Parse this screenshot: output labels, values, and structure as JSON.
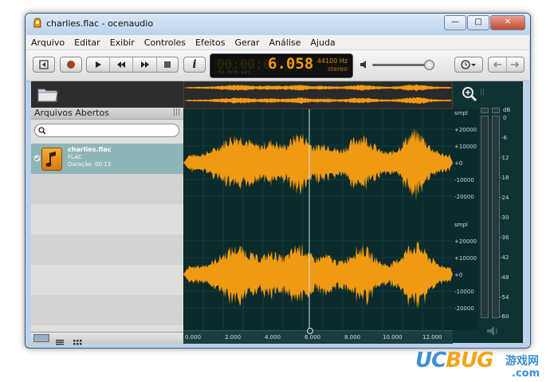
{
  "window": {
    "title": "charlies.flac - ocenaudio"
  },
  "menu": [
    "Arquivo",
    "Editar",
    "Exibir",
    "Controles",
    "Efeitos",
    "Gerar",
    "Análise",
    "Ajuda"
  ],
  "display": {
    "dim_digits": "00:00:0",
    "time": "6.058",
    "units": "hr  min sec",
    "sample_rate": "44100 Hz",
    "channels": "stereo"
  },
  "sidebar": {
    "header": "Arquivos Abertos",
    "search_placeholder": "",
    "files": [
      {
        "name": "charlies.flac",
        "format": "FLAC",
        "duration": "Duração: 00:13"
      }
    ]
  },
  "waveform": {
    "y_axis_top": [
      "smpl",
      "+20000",
      "+10000",
      "+0",
      "-10000",
      "-20000"
    ],
    "y_axis_bottom": [
      "smpl",
      "+20000",
      "+10000",
      "+0",
      "-10000",
      "-20000"
    ],
    "timeline": [
      "0.000",
      "2.000",
      "4.000",
      "6.000",
      "8.000",
      "10.000",
      "12.000"
    ],
    "playhead_seconds": 6.058,
    "duration_seconds": 13
  },
  "meter": {
    "unit": "dB",
    "scale": [
      "0",
      "-6",
      "-12",
      "-18",
      "-24",
      "-30",
      "-36",
      "-42",
      "-48",
      "-54",
      "-60"
    ]
  },
  "colors": {
    "wave": "#f09a13",
    "lcd": "#f29a0c",
    "background": "#0f3233",
    "selection": "#8fb5b6"
  }
}
